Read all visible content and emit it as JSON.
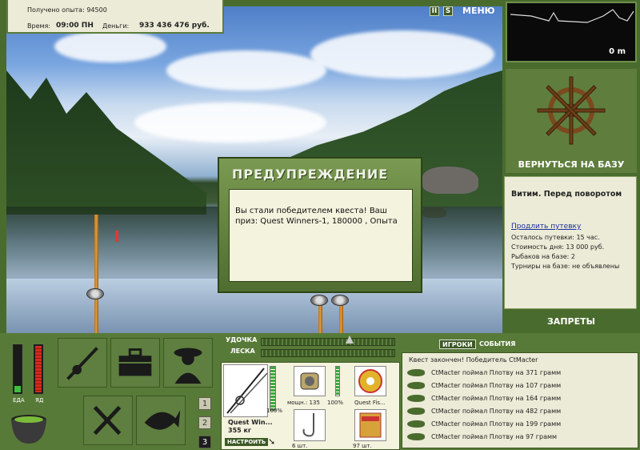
{
  "top_info": {
    "xp_label": "Получено опыта:",
    "xp_value": "94500",
    "time_label": "Время:",
    "time_value": "09:00 ПН",
    "money_label": "Деньги:",
    "money_value": "933 436 476 руб."
  },
  "top_buttons": {
    "pause": "II",
    "sound": "S",
    "menu": "МЕНЮ"
  },
  "depth": {
    "readout": "0 m"
  },
  "right_panel": {
    "return_label": "ВЕРНУТЬСЯ НА БАЗУ",
    "location": "Витим. Перед поворотом",
    "extend_link": "Продлить путевку",
    "lines": [
      "Осталось путевки: 15 час.",
      "Стоимость дня: 13 000 руб.",
      "Рыбаков на базе: 2",
      "Турниры на базе: не объявлены"
    ],
    "bans_label": "ЗАПРЕТЫ"
  },
  "dialog": {
    "title": "ПРЕДУПРЕЖДЕНИЕ",
    "message": "Вы стали победителем квеста! Ваш приз: Quest Winners-1, 180000 , Опыта"
  },
  "meters": {
    "food_label": "ЕДА",
    "poison_label": "ЯД"
  },
  "slots": {
    "numbers": [
      "1",
      "2",
      "3"
    ]
  },
  "tackle": {
    "rod_label": "УДОЧКА",
    "line_label": "ЛЕСКА",
    "rod_name": "Quest Win...",
    "rod_weight": "355 кг",
    "rod_percent": "100%",
    "setup_button": "НАСТРОИТЬ",
    "reel_label": "мощн.: 135",
    "reel_percent": "100%",
    "line_item_label": "Quest Fis...",
    "hook_count": "6 шт.",
    "bait_count": "97 шт."
  },
  "events": {
    "tab_players": "ИГРОКИ",
    "tab_events": "СОБЫТИЯ",
    "header": "Квест закончен! Победитель CtMacter",
    "rows": [
      "CtMacter поймал Плотву на 371 грамм",
      "CtMacter поймал Плотву на 107 грамм",
      "CtMacter поймал Плотву на 164 грамм",
      "CtMacter поймал Плотву на 482 грамм",
      "CtMacter поймал Плотву на 199 грамм",
      "CtMacter поймал Плотву на 97 грамм"
    ]
  },
  "colors": {
    "panel_green": "#587a38",
    "panel_light": "#ecebd7",
    "dialog_green": "#5f7e3e",
    "food_meter": "#3fbf3f",
    "poison_meter": "#d42a1a"
  }
}
